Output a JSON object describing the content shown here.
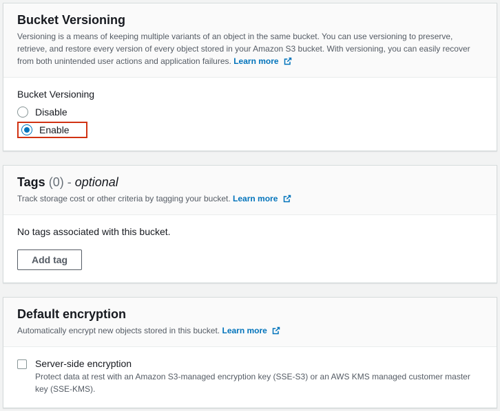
{
  "versioning": {
    "title": "Bucket Versioning",
    "description": "Versioning is a means of keeping multiple variants of an object in the same bucket. You can use versioning to preserve, retrieve, and restore every version of every object stored in your Amazon S3 bucket. With versioning, you can easily recover from both unintended user actions and application failures.",
    "learn_more": "Learn more",
    "field_label": "Bucket Versioning",
    "option_disable": "Disable",
    "option_enable": "Enable"
  },
  "tags": {
    "title": "Tags",
    "count": "(0)",
    "dash": "-",
    "optional": "optional",
    "description": "Track storage cost or other criteria by tagging your bucket.",
    "learn_more": "Learn more",
    "empty": "No tags associated with this bucket.",
    "add_button": "Add tag"
  },
  "encryption": {
    "title": "Default encryption",
    "description": "Automatically encrypt new objects stored in this bucket.",
    "learn_more": "Learn more",
    "sse_title": "Server-side encryption",
    "sse_desc": "Protect data at rest with an Amazon S3-managed encryption key (SSE-S3) or an AWS KMS managed customer master key (SSE-KMS)."
  }
}
